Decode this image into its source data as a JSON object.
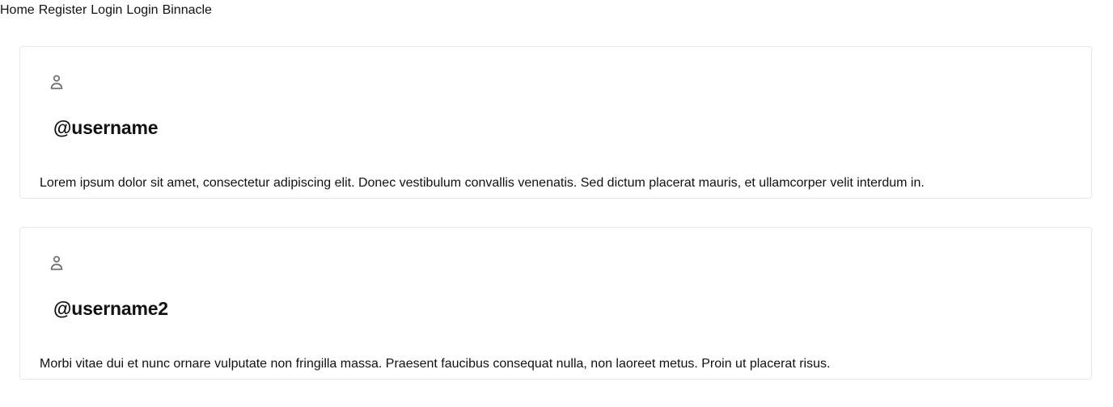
{
  "nav": {
    "items": [
      {
        "label": "Home"
      },
      {
        "label": "Register"
      },
      {
        "label": "Login"
      },
      {
        "label": "Login"
      },
      {
        "label": "Binnacle"
      }
    ]
  },
  "posts": [
    {
      "avatar_icon": "user-icon",
      "username": "@username",
      "content": "Lorem ipsum dolor sit amet, consectetur adipiscing elit. Donec vestibulum convallis venenatis. Sed dictum placerat mauris, et ullamcorper velit interdum in."
    },
    {
      "avatar_icon": "user-icon",
      "username": "@username2",
      "content": "Morbi vitae dui et nunc ornare vulputate non fringilla massa. Praesent faucibus consequat nulla, non laoreet metus. Proin ut placerat risus."
    }
  ],
  "colors": {
    "text": "#111111",
    "border": "#e7e7e7",
    "icon": "#6e6e6e",
    "background": "#ffffff"
  }
}
